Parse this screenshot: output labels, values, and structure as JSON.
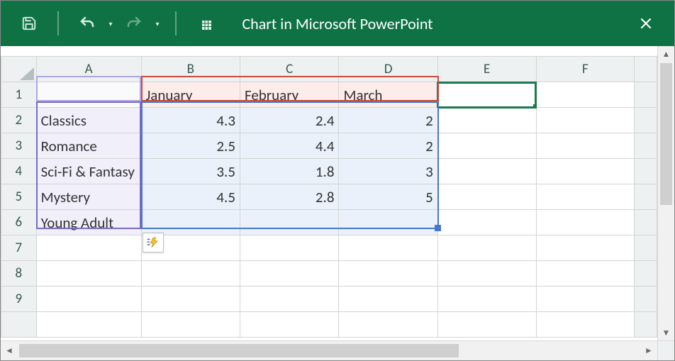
{
  "window": {
    "title": "Chart in Microsoft PowerPoint"
  },
  "columns": [
    "A",
    "B",
    "C",
    "D",
    "E",
    "F"
  ],
  "rows": [
    "1",
    "2",
    "3",
    "4",
    "5",
    "6",
    "7",
    "8",
    "9"
  ],
  "active_cell": "E1",
  "grid": {
    "headers": {
      "b": "January",
      "c": "February",
      "d": "March"
    },
    "r2": {
      "a": "Classics",
      "b": "4.3",
      "c": "2.4",
      "d": "2"
    },
    "r3": {
      "a": "Romance",
      "b": "2.5",
      "c": "4.4",
      "d": "2"
    },
    "r4": {
      "a": "Sci-Fi & Fantasy",
      "b": "3.5",
      "c": "1.8",
      "d": "3"
    },
    "r5": {
      "a": "Mystery",
      "b": "4.5",
      "c": "2.8",
      "d": "5"
    },
    "r6": {
      "a": "Young Adult"
    }
  },
  "chart_data": {
    "type": "bar",
    "categories": [
      "Classics",
      "Romance",
      "Sci-Fi & Fantasy",
      "Mystery",
      "Young Adult"
    ],
    "series": [
      {
        "name": "January",
        "values": [
          4.3,
          2.5,
          3.5,
          4.5,
          null
        ]
      },
      {
        "name": "February",
        "values": [
          2.4,
          4.4,
          1.8,
          2.8,
          null
        ]
      },
      {
        "name": "March",
        "values": [
          2,
          2,
          3,
          5,
          null
        ]
      }
    ]
  }
}
